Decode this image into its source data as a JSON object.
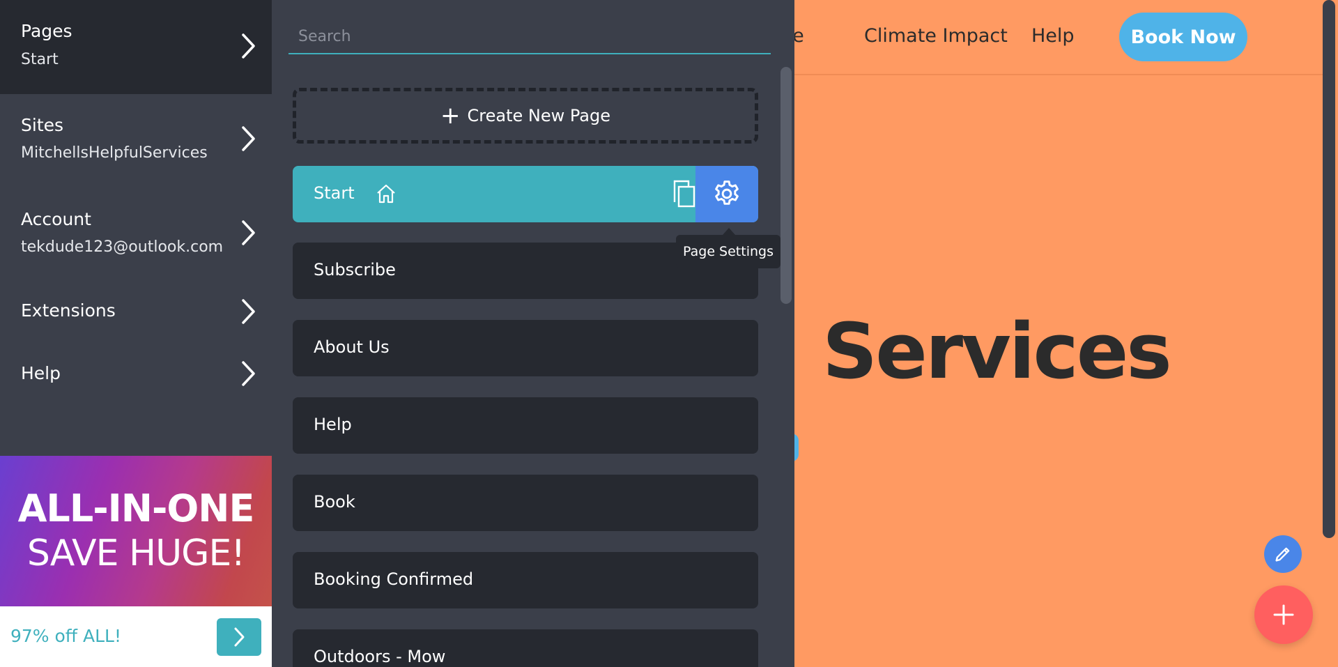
{
  "left_nav": {
    "items": [
      {
        "label": "Pages",
        "sub": "Start"
      },
      {
        "label": "Sites",
        "sub": "MitchellsHelpfulServices"
      },
      {
        "label": "Account",
        "sub": "tekdude123@outlook.com"
      },
      {
        "label": "Extensions",
        "sub": ""
      },
      {
        "label": "Help",
        "sub": ""
      }
    ],
    "active_index": 0
  },
  "promo": {
    "line1": "ALL-IN-ONE",
    "line2": "SAVE HUGE!",
    "offer": "97% off ALL!"
  },
  "pages_panel": {
    "search_placeholder": "Search",
    "create_label": "Create New Page",
    "pages": [
      {
        "title": "Start",
        "home": true
      },
      {
        "title": "Subscribe"
      },
      {
        "title": "About Us"
      },
      {
        "title": "Help"
      },
      {
        "title": "Book"
      },
      {
        "title": "Booking Confirmed"
      },
      {
        "title": "Outdoors - Mow"
      }
    ],
    "tooltip": "Page Settings"
  },
  "site": {
    "nav": [
      "be",
      "Climate Impact",
      "Help"
    ],
    "cta": "Book Now",
    "hero_partial": "l Services"
  },
  "colors": {
    "panel_bg": "#3b3f4a",
    "dark": "#262930",
    "accent_teal": "#3fb0bd",
    "accent_blue": "#4a86e8",
    "site_bg": "#ff9a62",
    "fab_red": "#ff5f5f"
  },
  "icons": [
    "chevron-right-icon",
    "plus-icon",
    "home-icon",
    "copy-icon",
    "gear-icon",
    "pencil-icon"
  ]
}
